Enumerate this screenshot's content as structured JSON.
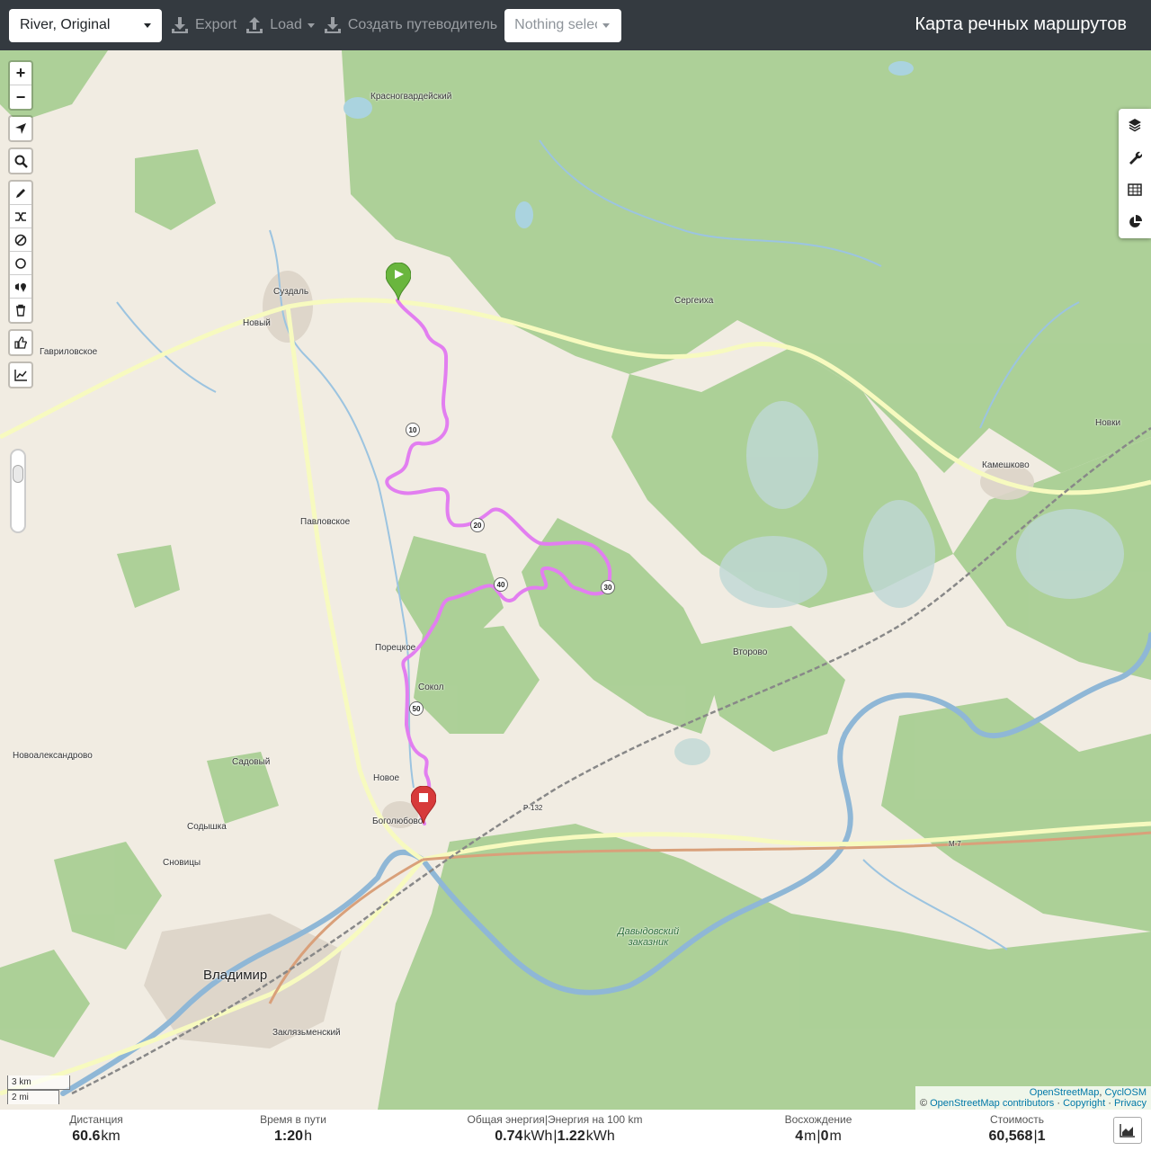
{
  "navbar": {
    "profile": "River, Original",
    "export_label": "Export",
    "load_label": "Load",
    "guide_label": "Создать путеводитель",
    "nothing_selected": "Nothing selected",
    "title": "Карта речных маршрутов"
  },
  "map": {
    "places": {
      "krasnogvardeysky": "Красногвардейский",
      "suzdal": "Суздаль",
      "novy": "Новый",
      "gavrilovskoe": "Гавриловское",
      "sergeikha": "Сергеиха",
      "novki": "Новки",
      "kameshkovo": "Камешково",
      "pavlovskoe": "Павловское",
      "vtorovo": "Второво",
      "poretskoe": "Порецкое",
      "sokol": "Сокол",
      "novoalexandrovo": "Новоалександрово",
      "sadovy": "Садовый",
      "novoe": "Новое",
      "bogolyubovo": "Боголюбово",
      "sodyshka": "Содышка",
      "snovitsy": "Сновицы",
      "vladimir": "Владимир",
      "zaklyazmensky": "Заклязьменский",
      "reserve": "Давыдовский заказник"
    },
    "road_labels": {
      "r132": "Р-132",
      "m7": "М-7"
    },
    "km_markers": [
      "10",
      "20",
      "30",
      "40",
      "50"
    ],
    "scale": {
      "metric": "3 km",
      "imperial": "2 mi"
    },
    "attribution": {
      "tiles": "OpenStreetMap",
      "tiles2": "CyclOSM",
      "copyright_prefix": "©",
      "contributors": "OpenStreetMap contributors",
      "copyright": "Copyright",
      "privacy": "Privacy"
    },
    "icons": {
      "zoom_in": "+",
      "zoom_out": "−",
      "left_tools": [
        "locate-icon",
        "search-icon",
        "draw-icon",
        "reverse-icon",
        "delete-icon",
        "circle-icon",
        "poi-icon",
        "trash-icon",
        "thumb-icon",
        "chart-icon"
      ],
      "right_tools": [
        "layers-icon",
        "wrench-icon",
        "table-icon",
        "pie-icon"
      ]
    },
    "colors": {
      "route": "#e27ef0",
      "start": "#6ab63e",
      "end": "#d73a3a"
    }
  },
  "stats": {
    "distance": {
      "label": "Дистанция",
      "value": "60.6",
      "unit": "km"
    },
    "time": {
      "label": "Время в пути",
      "value": "1:20",
      "unit": "h"
    },
    "energy": {
      "label": "Общая энергия",
      "sep": "|",
      "label2": "Энергия на 100 km",
      "value": "0.74",
      "unit": "kWh",
      "value2": "1.22",
      "unit2": "kWh"
    },
    "ascent": {
      "label": "Восхождение",
      "value": "4",
      "unit": "m",
      "value2": "0",
      "unit2": "m"
    },
    "cost": {
      "label": "Стоимость",
      "value": "60,568",
      "value2": "1"
    }
  }
}
